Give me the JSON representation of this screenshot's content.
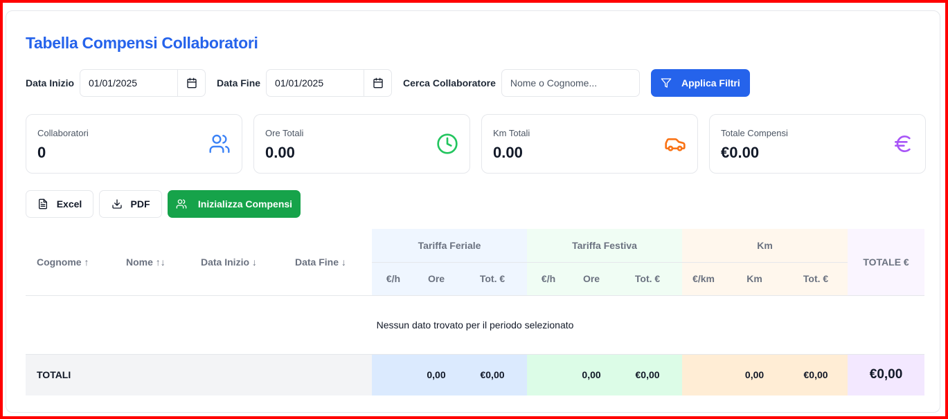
{
  "title": "Tabella Compensi Collaboratori",
  "filters": {
    "start_label": "Data Inizio",
    "start_value": "01/01/2025",
    "end_label": "Data Fine",
    "end_value": "01/01/2025",
    "search_label": "Cerca Collaboratore",
    "search_placeholder": "Nome o Cognome...",
    "apply_label": "Applica Filtri"
  },
  "stats": [
    {
      "label": "Collaboratori",
      "value": "0",
      "icon": "users-icon",
      "color": "#3b82f6"
    },
    {
      "label": "Ore Totali",
      "value": "0.00",
      "icon": "clock-icon",
      "color": "#22c55e"
    },
    {
      "label": "Km Totali",
      "value": "0.00",
      "icon": "car-icon",
      "color": "#f97316"
    },
    {
      "label": "Totale Compensi",
      "value": "€0.00",
      "icon": "euro-icon",
      "color": "#a855f7"
    }
  ],
  "actions": {
    "excel_label": "Excel",
    "pdf_label": "PDF",
    "init_label": "Inizializza Compensi"
  },
  "table": {
    "columns": [
      "Cognome ↑",
      "Nome ↑↓",
      "Data Inizio ↓",
      "Data Fine ↓"
    ],
    "groups": [
      "Tariffa Feriale",
      "Tariffa Festiva",
      "Km"
    ],
    "total_header": "TOTALE €",
    "sub_feriale": [
      "€/h",
      "Ore",
      "Tot. €"
    ],
    "sub_festiva": [
      "€/h",
      "Ore",
      "Tot. €"
    ],
    "sub_km": [
      "€/km",
      "Km",
      "Tot. €"
    ],
    "empty_message": "Nessun dato trovato per il periodo selezionato",
    "totals": {
      "label": "TOTALI",
      "feriale_ore": "0,00",
      "feriale_tot": "€0,00",
      "festiva_ore": "0,00",
      "festiva_tot": "€0,00",
      "km_km": "0,00",
      "km_tot": "€0,00",
      "grand_total": "€0,00"
    }
  }
}
